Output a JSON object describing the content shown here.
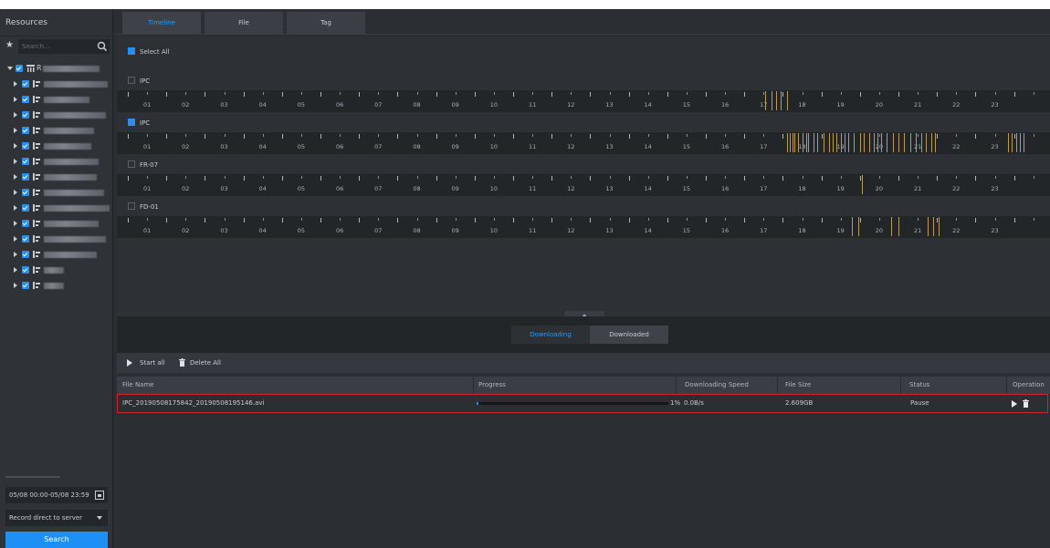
{
  "sidebar": {
    "title": "Resources",
    "search_placeholder": "Search...",
    "root_label": "R",
    "date_range": "05/08 00:00-05/08 23:59",
    "storage_option": "Record direct to server",
    "search_button": "Search"
  },
  "tabs": [
    "Timeline",
    "File",
    "Tag"
  ],
  "timeline": {
    "select_all": "Select All",
    "cameras": [
      {
        "name": "IPC",
        "checked": false
      },
      {
        "name": "IPC",
        "checked": true
      },
      {
        "name": "FR-07",
        "checked": false
      },
      {
        "name": "FD-01",
        "checked": false
      }
    ],
    "hours": [
      "01",
      "02",
      "03",
      "04",
      "05",
      "06",
      "07",
      "08",
      "09",
      "10",
      "11",
      "12",
      "13",
      "14",
      "15",
      "16",
      "17",
      "18",
      "19",
      "20",
      "21",
      "22",
      "23"
    ]
  },
  "downloads": {
    "tab_downloading": "Downloading",
    "tab_downloaded": "Downloaded",
    "start_all": "Start all",
    "delete_all": "Delete All",
    "columns": [
      "File Name",
      "Progress",
      "Downloading Speed",
      "File Size",
      "Status",
      "Operation"
    ],
    "rows": [
      {
        "file_name": "IPC_20190508175842_20190508195146.avi",
        "progress": 0.01,
        "progress_text": "1%",
        "speed": "0.0B/s",
        "size": "2.609GB",
        "status": "Pause"
      }
    ]
  },
  "colors": {
    "accent": "#2a8ef0",
    "highlight_border": "#d0232b",
    "record_mark": "#b89b5a"
  }
}
